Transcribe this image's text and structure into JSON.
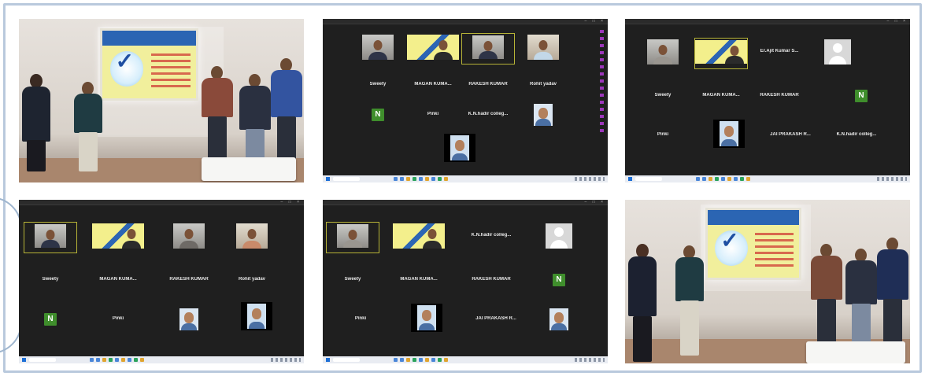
{
  "panels": {
    "zoom_a": {
      "rows": [
        [
          "Sweety",
          "MAGAN KUMA...",
          "RAKESH KUMAR",
          "Rohit yadav"
        ],
        [
          "N",
          "Pinki",
          "K.N.hadir colleg...",
          ""
        ],
        [
          ""
        ]
      ]
    },
    "zoom_b": {
      "rows": [
        [
          "",
          "",
          "Er.Ajit Kumar S...",
          ""
        ],
        [
          "Sweety",
          "MAGAN KUMA...",
          "RAKESH KUMAR",
          "N"
        ],
        [
          "Pinki",
          "",
          "JAI PRAKASH R...",
          "K.N.hadir colleg..."
        ]
      ]
    },
    "zoom_c": {
      "rows": [
        [
          "",
          "",
          "",
          ""
        ],
        [
          "Sweety",
          "MAGAN KUMA...",
          "RAKESH KUMAR",
          "Rohit yadav"
        ],
        [
          "N",
          "Pinki",
          "",
          ""
        ]
      ]
    },
    "zoom_d": {
      "rows": [
        [
          "",
          "",
          "K.N.hadir colleg...",
          ""
        ],
        [
          "Sweety",
          "MAGAN KUMA...",
          "RAKESH KUMAR",
          "N"
        ],
        [
          "Pinki",
          "",
          "JAI PRAKASH R...",
          ""
        ]
      ]
    }
  }
}
